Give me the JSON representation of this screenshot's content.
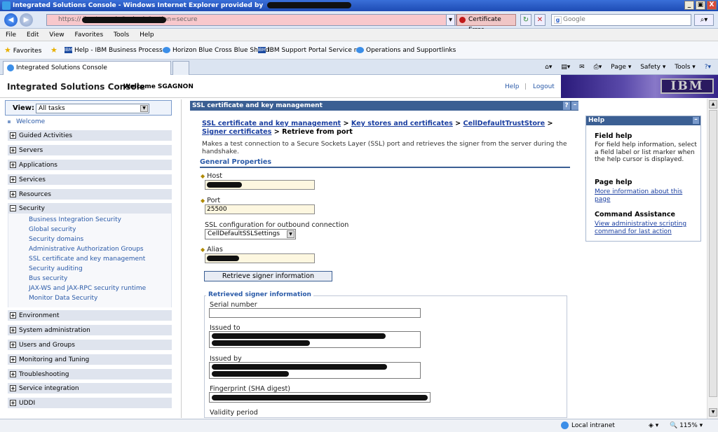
{
  "window": {
    "title": "Integrated Solutions Console - Windows Internet Explorer provided by",
    "min": "_",
    "max": "▣",
    "close": "X"
  },
  "address": {
    "url": "https://                    ibm/console/login.do?action=secure",
    "cert_error": "Certificate Error",
    "search_placeholder": "Google"
  },
  "menu": [
    "File",
    "Edit",
    "View",
    "Favorites",
    "Tools",
    "Help"
  ],
  "favorites": {
    "label": "Favorites",
    "items": [
      "Help - IBM Business Process...",
      "Horizon Blue Cross Blue Shield",
      "IBM Support Portal Service r...",
      "Operations and Supportlinks"
    ]
  },
  "tab": {
    "title": "Integrated Solutions Console"
  },
  "commandbar": [
    "Page ▾",
    "Safety ▾",
    "Tools ▾"
  ],
  "console": {
    "title": "Integrated Solutions Console",
    "welcome": "Welcome SGAGNON",
    "help": "Help",
    "divider": "|",
    "logout": "Logout",
    "logo": "IBM"
  },
  "nav": {
    "view_label": "View:",
    "view_value": "All tasks",
    "welcome": "Welcome",
    "groups": [
      "Guided Activities",
      "Servers",
      "Applications",
      "Services",
      "Resources",
      "Security",
      "Environment",
      "System administration",
      "Users and Groups",
      "Monitoring and Tuning",
      "Troubleshooting",
      "Service integration",
      "UDDI"
    ],
    "security_items": [
      "Business Integration Security",
      "Global security",
      "Security domains",
      "Administrative Authorization Groups",
      "SSL certificate and key management",
      "Security auditing",
      "Bus security",
      "JAX-WS and JAX-RPC security runtime",
      "Monitor Data Security"
    ]
  },
  "panel": {
    "title": "SSL certificate and key management",
    "q": "?",
    "min": "–",
    "crumb": {
      "c1": "SSL certificate and key management",
      "sep": " > ",
      "c2": "Key stores and certificates",
      "c3": "CellDefaultTrustStore",
      "c4": "Signer certificates",
      "c5": "Retrieve from port"
    },
    "description": "Makes a test connection to a Secure Sockets Layer (SSL) port and retrieves the signer from the server during the handshake.",
    "general_properties": "General Properties",
    "host_label": "Host",
    "port_label": "Port",
    "port_value": "25500",
    "ssl_label": "SSL configuration for outbound connection",
    "ssl_value": "CellDefaultSSLSettings",
    "alias_label": "Alias",
    "retrieve_button": "Retrieve signer information",
    "retrieved_legend": "Retrieved signer information",
    "serial_label": "Serial number",
    "issued_to_label": "Issued to",
    "issued_by_label": "Issued by",
    "fingerprint_label": "Fingerprint (SHA digest)",
    "validity_label": "Validity period"
  },
  "helppane": {
    "title": "Help",
    "field_h": "Field help",
    "field_t": "For field help information, select a field label or list marker when the help cursor is displayed.",
    "page_h": "Page help",
    "page_link": "More information about this page",
    "cmd_h": "Command Assistance",
    "cmd_link": "View administrative scripting command for last action"
  },
  "status": {
    "zone": "Local intranet",
    "zoom": "115%"
  },
  "colors": {
    "panel_header": "#3b5f93",
    "link": "#1a3ea0",
    "nav_group": "#dfe4ee",
    "required_field": "#fdf7e0",
    "url_error": "#f8c8cc"
  }
}
